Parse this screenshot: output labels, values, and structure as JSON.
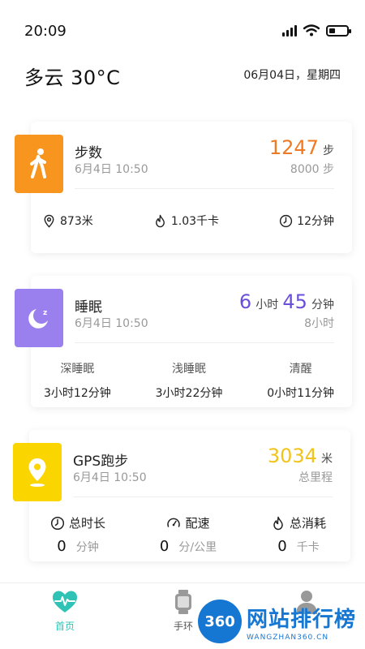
{
  "status_bar": {
    "time": "20:09"
  },
  "header": {
    "weather": "多云 30°C",
    "date": "06月04日，星期四"
  },
  "steps_card": {
    "title": "步数",
    "datetime": "6月4日 10:50",
    "count": "1247",
    "count_unit": "步",
    "goal": "8000 步",
    "accent": "#f07a23",
    "icon_color": "#f7951e",
    "distance": "873米",
    "calories": "1.03千卡",
    "duration": "12分钟"
  },
  "sleep_card": {
    "title": "睡眠",
    "datetime": "6月4日 10:50",
    "hours": "6",
    "hours_unit": "小时",
    "minutes": "45",
    "minutes_unit": "分钟",
    "goal": "8小时",
    "accent": "#6b4fd8",
    "icon_color": "#9a7fef",
    "deep_label": "深睡眠",
    "deep_value": "3小时12分钟",
    "light_label": "浅睡眠",
    "light_value": "3小时22分钟",
    "awake_label": "清醒",
    "awake_value": "0小时11分钟"
  },
  "gps_card": {
    "title": "GPS跑步",
    "datetime": "6月4日 10:50",
    "distance": "3034",
    "distance_unit": "米",
    "distance_label": "总里程",
    "accent": "#f2c31b",
    "icon_color": "#fbd500",
    "total_time_label": "总时长",
    "total_time_value": "0",
    "total_time_unit": "分钟",
    "pace_label": "配速",
    "pace_value": "0",
    "pace_unit": "分/公里",
    "calories_label": "总消耗",
    "calories_value": "0",
    "calories_unit": "千卡"
  },
  "tabbar": {
    "home_label": "首页",
    "band_label": "手环",
    "active_color": "#2ec3b5"
  },
  "watermark": {
    "badge": "360",
    "title": "网站排行榜",
    "subtitle": "WANGZHAN360.CN"
  }
}
